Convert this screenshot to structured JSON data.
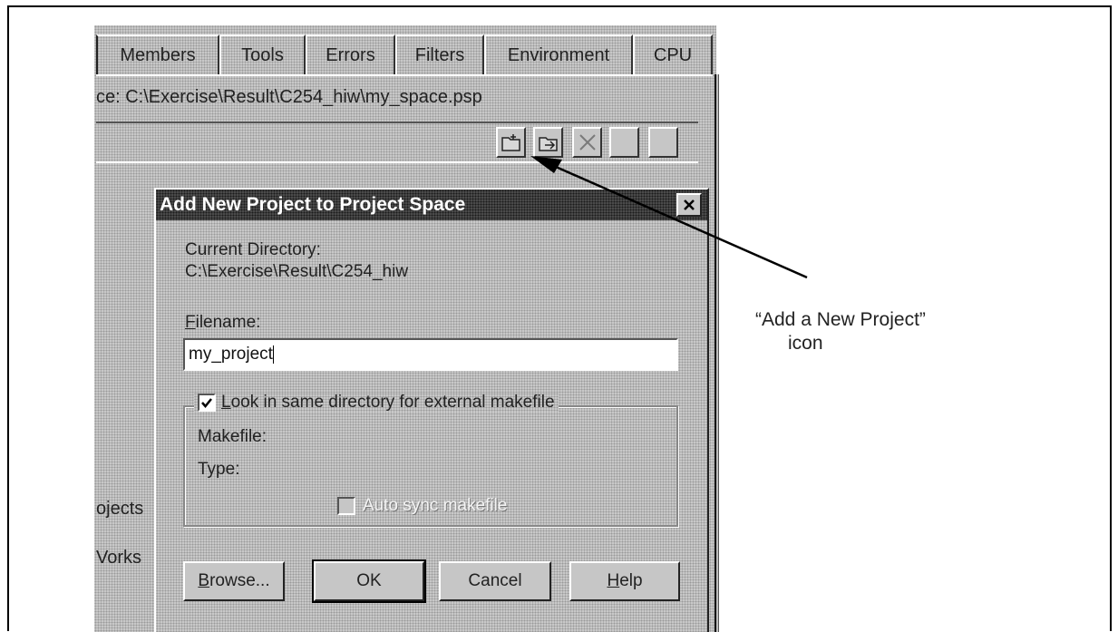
{
  "tabs": [
    "Members",
    "Tools",
    "Errors",
    "Filters",
    "Environment",
    "CPU"
  ],
  "workspace_path": "ce:  C:\\Exercise\\Result\\C254_hiw\\my_space.psp",
  "left_truncated": [
    "ojects",
    "Vorks"
  ],
  "dialog": {
    "title": "Add New Project to Project Space",
    "current_directory_label": "Current Directory:",
    "current_directory_value": "C:\\Exercise\\Result\\C254_hiw",
    "filename_label_first": "F",
    "filename_label_rest": "ilename:",
    "filename_value": "my_project",
    "look_checkbox_first": "L",
    "look_checkbox_rest": "ook in same directory for external makefile",
    "look_checked": true,
    "makefile_label": "Makefile:",
    "type_label": "Type:",
    "autosync_label": "Auto sync makefile",
    "buttons": {
      "browse_first": "B",
      "browse_rest": "rowse...",
      "ok": "OK",
      "cancel": "Cancel",
      "help_first": "H",
      "help_rest": "elp"
    }
  },
  "annotation": {
    "line1": "“Add a New Project”",
    "line2": "icon"
  },
  "icons": [
    "add-new-project-icon",
    "add-existing-project-icon",
    "delete-icon",
    "blank-icon",
    "blank-icon"
  ]
}
